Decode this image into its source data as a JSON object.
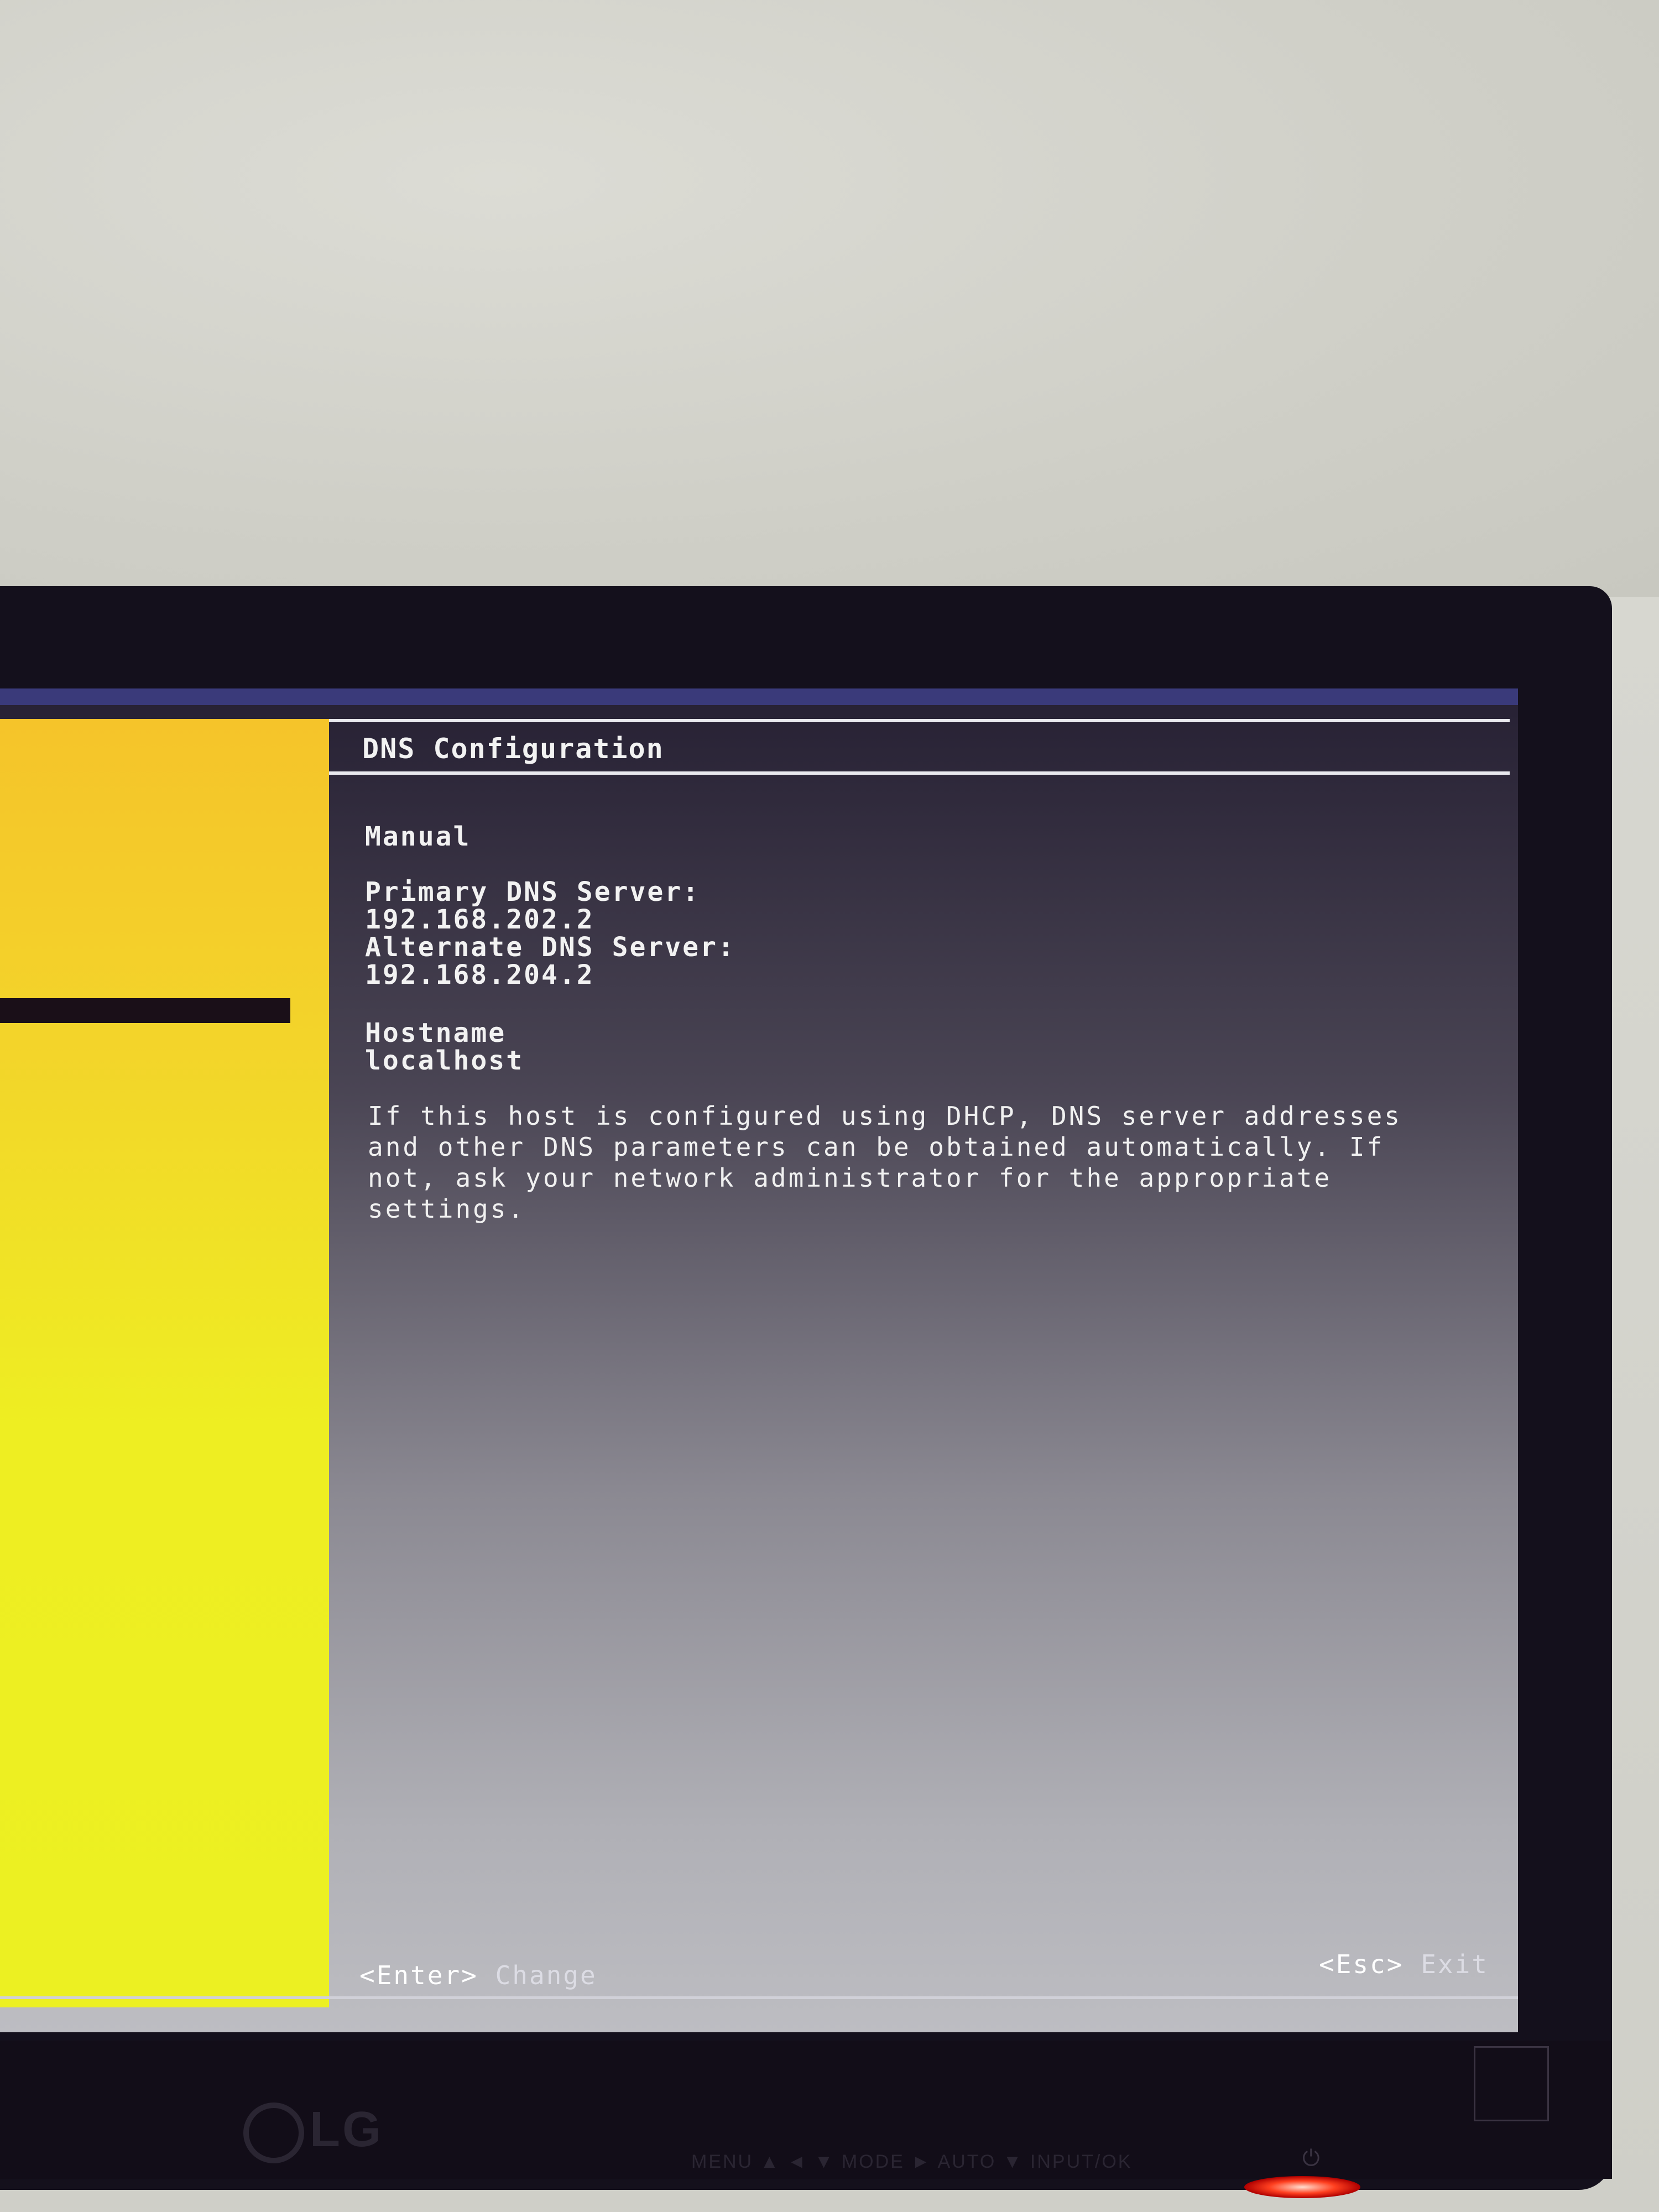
{
  "screen": {
    "title": "DNS Configuration",
    "mode": "Manual",
    "primary_dns": {
      "label": "Primary DNS Server:",
      "value": "192.168.202.2"
    },
    "alternate_dns": {
      "label": "Alternate DNS Server:",
      "value": "192.168.204.2"
    },
    "hostname": {
      "label": "Hostname",
      "value": "localhost"
    },
    "help_text": "If this host is configured using DHCP, DNS server addresses\nand other DNS parameters can be obtained automatically. If\nnot, ask your network administrator for the appropriate\nsettings.",
    "footer": {
      "enter_key": "<Enter>",
      "enter_action": "Change",
      "esc_key": "<Esc>",
      "esc_action": "Exit"
    }
  },
  "monitor": {
    "brand": "LG",
    "controls": "MENU ▲ ◄ ▼ MODE ► AUTO ▼ INPUT/OK"
  },
  "colors": {
    "left_panel": "#f3d42a",
    "screen_bg": "#8b8992",
    "text": "#f2f2f2"
  }
}
